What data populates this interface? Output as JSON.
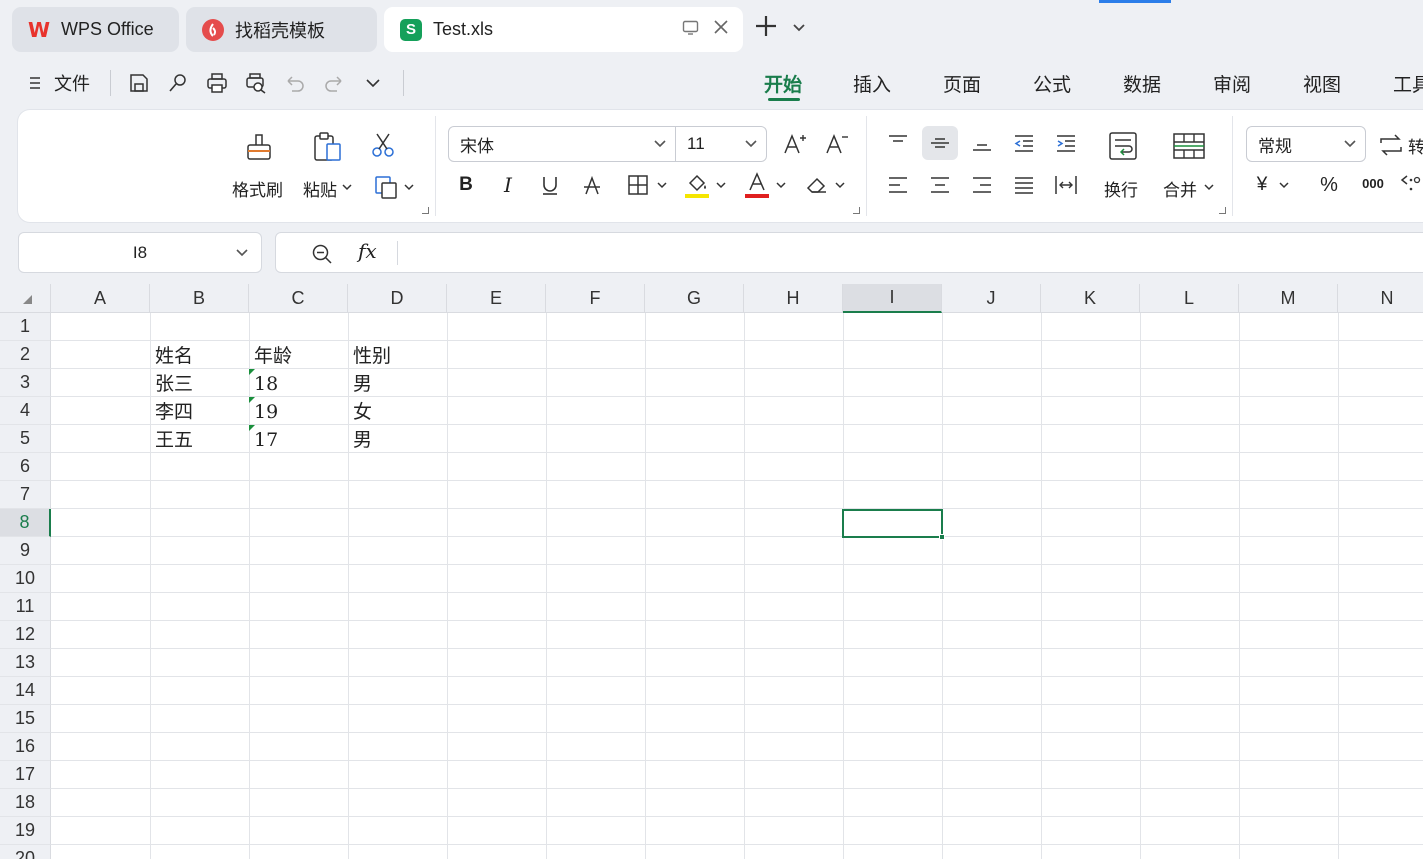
{
  "tabs": [
    {
      "label": "WPS Office",
      "logo": "W"
    },
    {
      "label": "找稻壳模板",
      "logo": "稻"
    },
    {
      "label": "Test.xls",
      "logo": "S"
    }
  ],
  "quick_access": {
    "file_label": "文件"
  },
  "menu_tabs": [
    "开始",
    "插入",
    "页面",
    "公式",
    "数据",
    "审阅",
    "视图",
    "工具"
  ],
  "active_menu_tab": "开始",
  "ribbon": {
    "format_painter": "格式刷",
    "paste": "粘贴",
    "font_name": "宋体",
    "font_size": "11",
    "wrap": "换行",
    "merge": "合并",
    "number_format": "常规",
    "convert": "转"
  },
  "formula_bar": {
    "cell_ref": "I8",
    "fx": "fx",
    "formula": ""
  },
  "sheet": {
    "columns": [
      "A",
      "B",
      "C",
      "D",
      "E",
      "F",
      "G",
      "H",
      "I",
      "J",
      "K",
      "L",
      "M",
      "N"
    ],
    "rows": [
      "1",
      "2",
      "3",
      "4",
      "5",
      "6",
      "7",
      "8",
      "9",
      "10",
      "11",
      "12",
      "13",
      "14",
      "15",
      "16",
      "17",
      "18",
      "19",
      "20"
    ],
    "active_column": "I",
    "active_row": "8",
    "cells": {
      "B2": "姓名",
      "C2": "年龄",
      "D2": "性别",
      "B3": "张三",
      "C3": "18",
      "D3": "男",
      "B4": "李四",
      "C4": "19",
      "D4": "女",
      "B5": "王五",
      "C5": "17",
      "D5": "男"
    }
  },
  "colors": {
    "accent": "#1a7d4c",
    "wps_red": "#e8322c",
    "sheet_green": "#15a05a"
  }
}
